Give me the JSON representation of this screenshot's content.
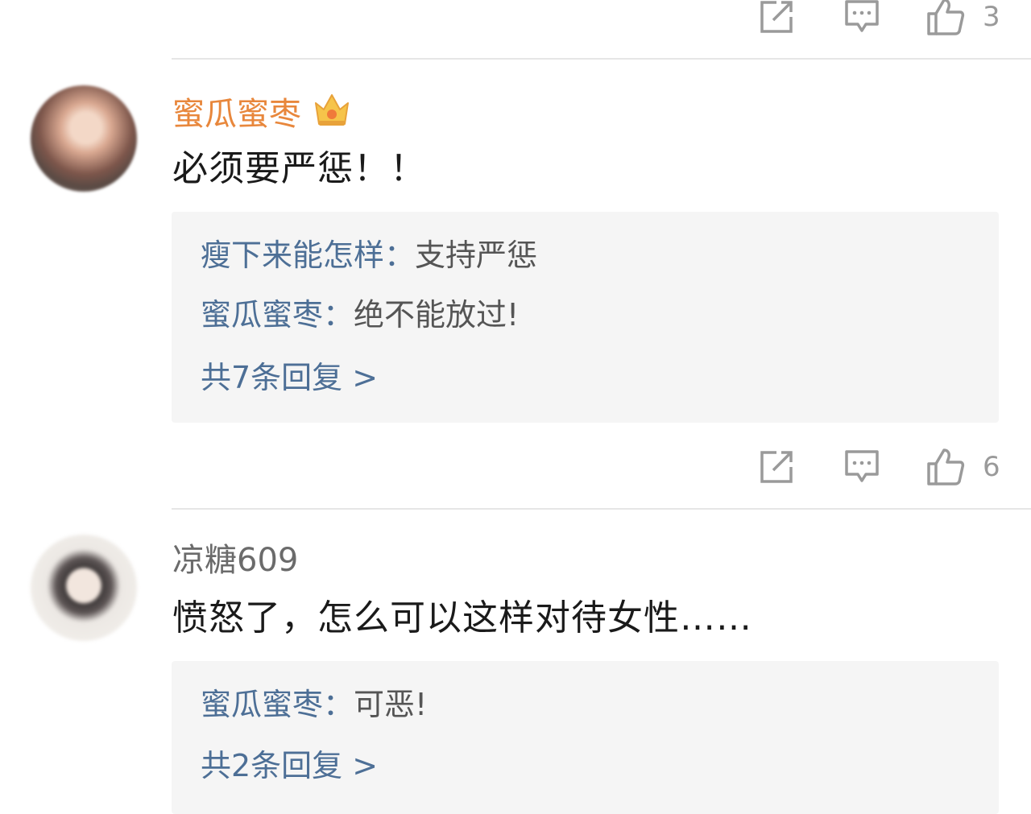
{
  "comments": [
    {
      "username": "蜜瓜蜜枣",
      "vip": true,
      "text": "必须要严惩！！",
      "replies": [
        {
          "name": "瘦下来能怎样",
          "colon": "：",
          "text": "支持严惩"
        },
        {
          "name": "蜜瓜蜜枣",
          "colon": "：",
          "text": "绝不能放过!"
        }
      ],
      "reply_count": "共7条回复 >",
      "likes": "6"
    },
    {
      "username": "凉糖609",
      "vip": false,
      "text": "愤怒了，怎么可以这样对待女性……",
      "replies": [
        {
          "name": "蜜瓜蜜枣",
          "colon": "：",
          "text": "可恶!"
        }
      ],
      "reply_count": "共2条回复 >"
    }
  ],
  "top_action_bar": {
    "likes": "3"
  },
  "icons": [
    "share-icon",
    "comment-icon",
    "like-icon",
    "crown-icon"
  ],
  "colors": {
    "vip_name": "#e8873c",
    "link_blue": "#4d6f96",
    "reply_bg": "#f5f5f5"
  }
}
